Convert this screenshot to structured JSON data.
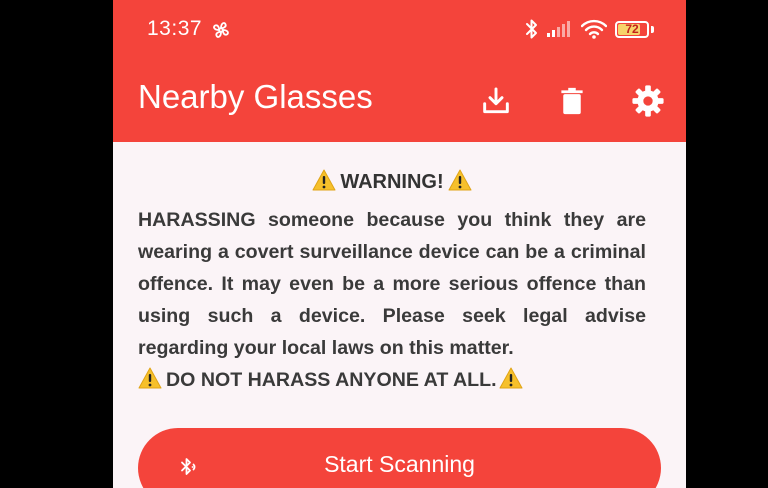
{
  "status_bar": {
    "time": "13:37",
    "battery_level": "72",
    "icons": [
      "fan-icon",
      "bluetooth-icon",
      "cellular-signal-icon",
      "wifi-icon",
      "battery-icon"
    ]
  },
  "app_bar": {
    "title": "Nearby Glasses",
    "actions": [
      "download-icon",
      "delete-icon",
      "settings-icon"
    ]
  },
  "warning": {
    "heading": "WARNING!",
    "body": "HARASSING someone because you think they are wearing a covert surveillance device can be a criminal offence. It may even be a more serious offence than using such a device. Please seek legal advise regarding your local laws on this matter.",
    "final": "DO NOT HARASS ANYONE AT ALL."
  },
  "scan_button": {
    "label": "Start Scanning",
    "icon": "bluetooth-searching-icon"
  },
  "colors": {
    "accent": "#f4443b",
    "background": "#fbf4f7",
    "text": "#333333",
    "warning_yellow": "#f6c02b"
  }
}
